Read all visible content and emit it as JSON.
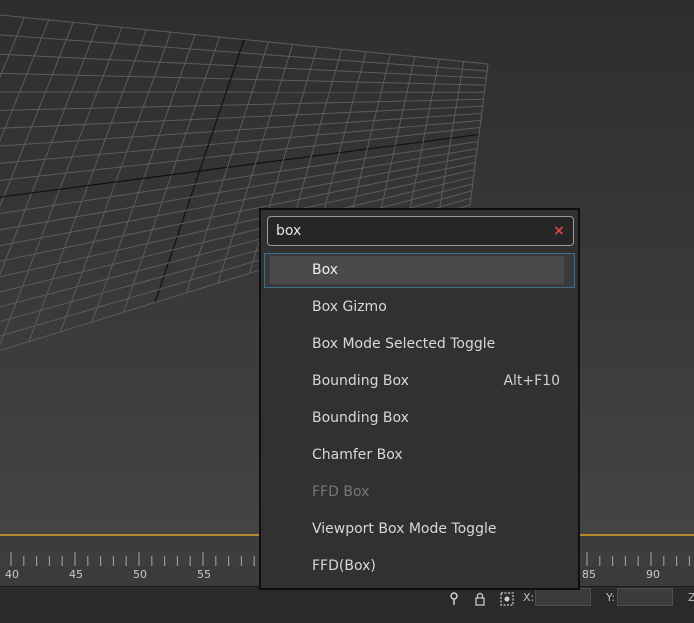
{
  "search": {
    "value": "box",
    "clear_icon": "close-icon",
    "clear_glyph": "×",
    "clear_color": "#e04545"
  },
  "results": [
    {
      "label": "Box",
      "shortcut": "",
      "selected": true,
      "disabled": false
    },
    {
      "label": "Box Gizmo",
      "shortcut": "",
      "selected": false,
      "disabled": false
    },
    {
      "label": "Box Mode Selected Toggle",
      "shortcut": "",
      "selected": false,
      "disabled": false
    },
    {
      "label": "Bounding Box",
      "shortcut": "Alt+F10",
      "selected": false,
      "disabled": false
    },
    {
      "label": "Bounding Box",
      "shortcut": "",
      "selected": false,
      "disabled": false
    },
    {
      "label": "Chamfer Box",
      "shortcut": "",
      "selected": false,
      "disabled": false
    },
    {
      "label": "FFD Box",
      "shortcut": "",
      "selected": false,
      "disabled": true
    },
    {
      "label": "Viewport Box Mode Toggle",
      "shortcut": "",
      "selected": false,
      "disabled": false
    },
    {
      "label": "FFD(Box)",
      "shortcut": "",
      "selected": false,
      "disabled": false
    }
  ],
  "timeline": {
    "tick_labels": [
      "40",
      "45",
      "50",
      "55",
      "85",
      "90"
    ]
  },
  "statusbar": {
    "x_label": "X:",
    "y_label": "Y:",
    "z_label": "Z",
    "icons": [
      "key-icon",
      "lock-icon",
      "selection-icon"
    ]
  },
  "colors": {
    "accent_timeline": "#b88a2e",
    "selection_border": "#3d6f8c"
  }
}
